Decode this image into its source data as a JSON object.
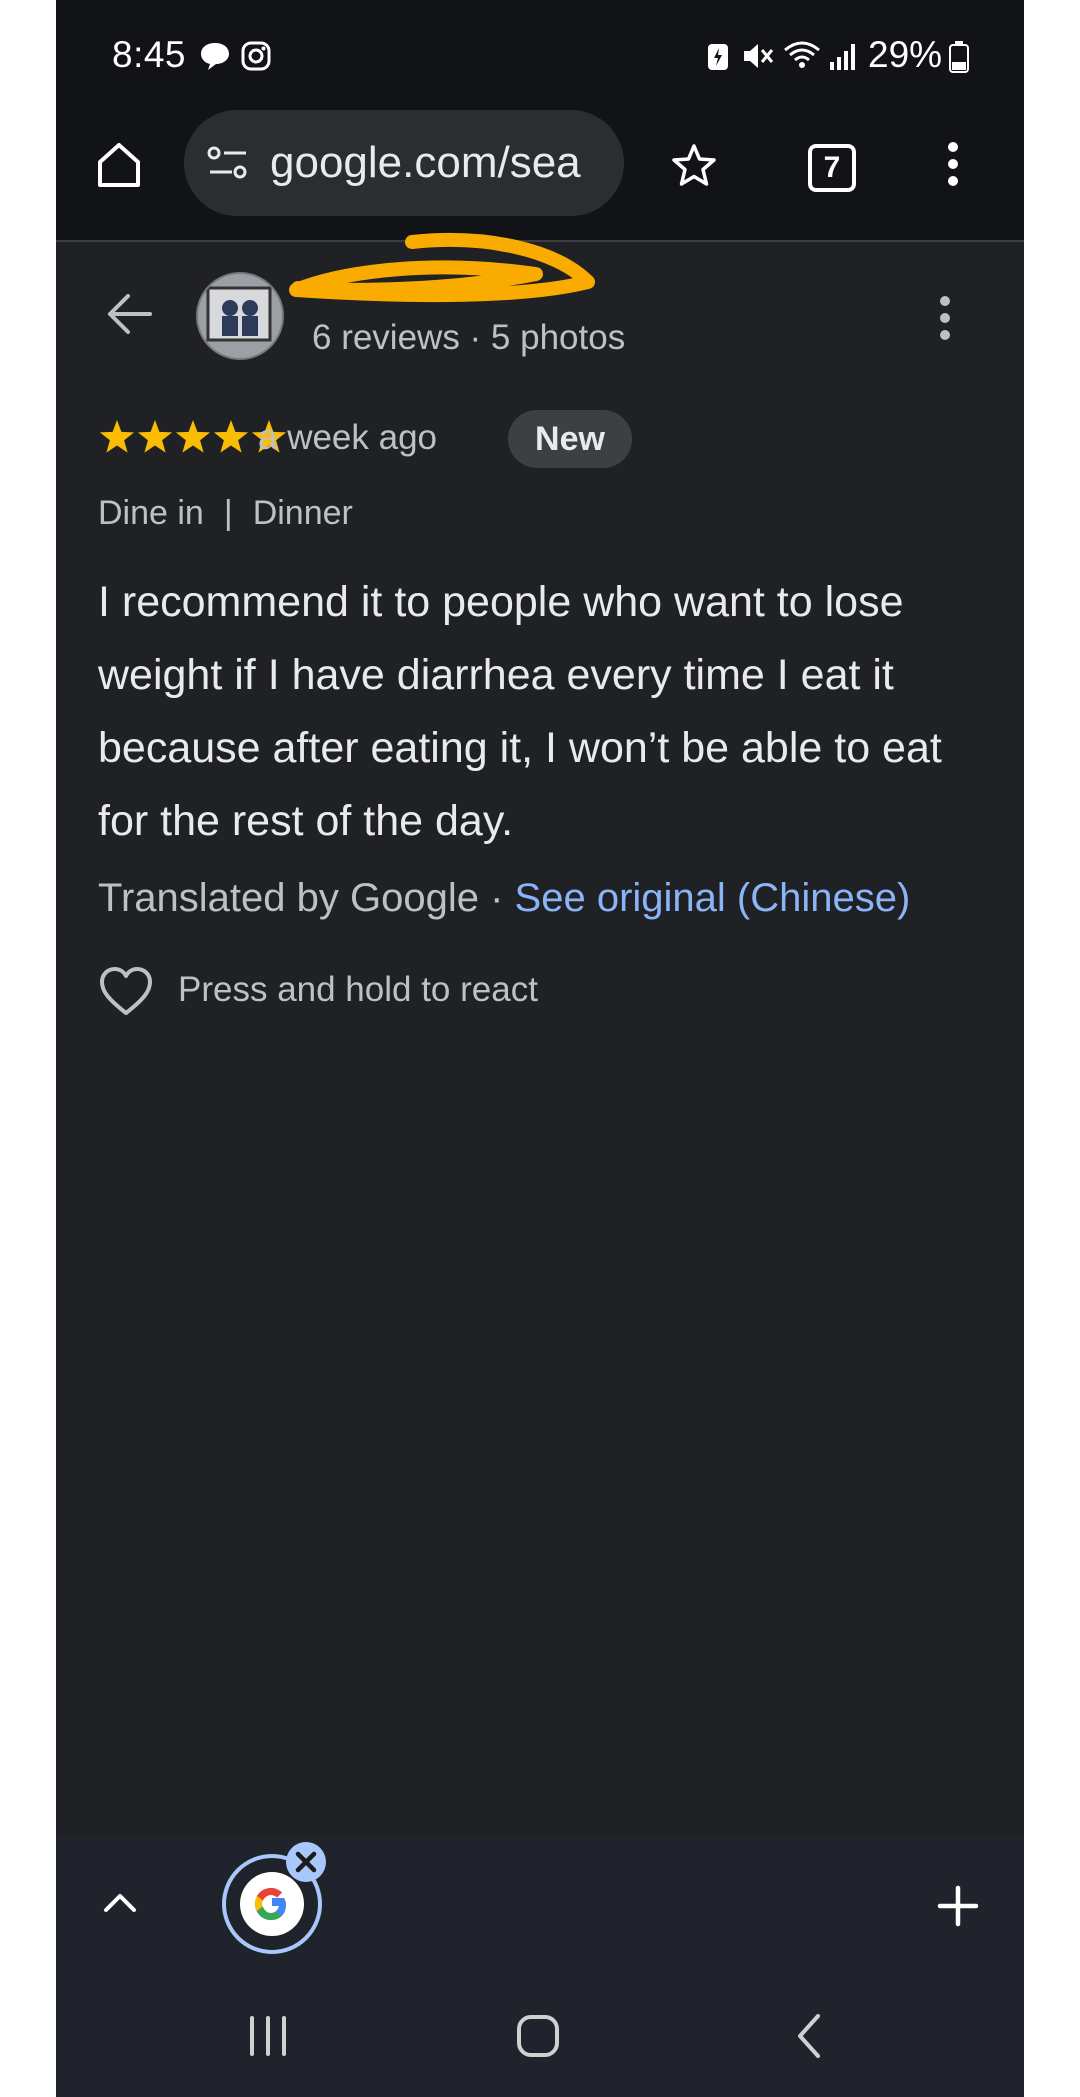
{
  "status_bar": {
    "time": "8:45",
    "battery": "29%"
  },
  "browser": {
    "url": "google.com/sea",
    "tab_count": "7"
  },
  "reviewer": {
    "stats": "6 reviews · 5 photos"
  },
  "review": {
    "rating": 5,
    "time": "a week ago",
    "badge": "New",
    "dine_type": "Dine in",
    "meal": "Dinner",
    "separator": "|",
    "text": "I recommend it to people who want to lose weight if I have diarrhea every time I eat it because after eating it, I won’t be able to eat for the rest of the day.",
    "translated_by": "Translated by Google",
    "dot": "·",
    "see_original": "See original (Chinese)",
    "react_hint": "Press and hold to react"
  },
  "colors": {
    "star": "#fbbc04",
    "link": "#8ab4f8",
    "scribble": "#f9ab00",
    "background": "#202124"
  }
}
